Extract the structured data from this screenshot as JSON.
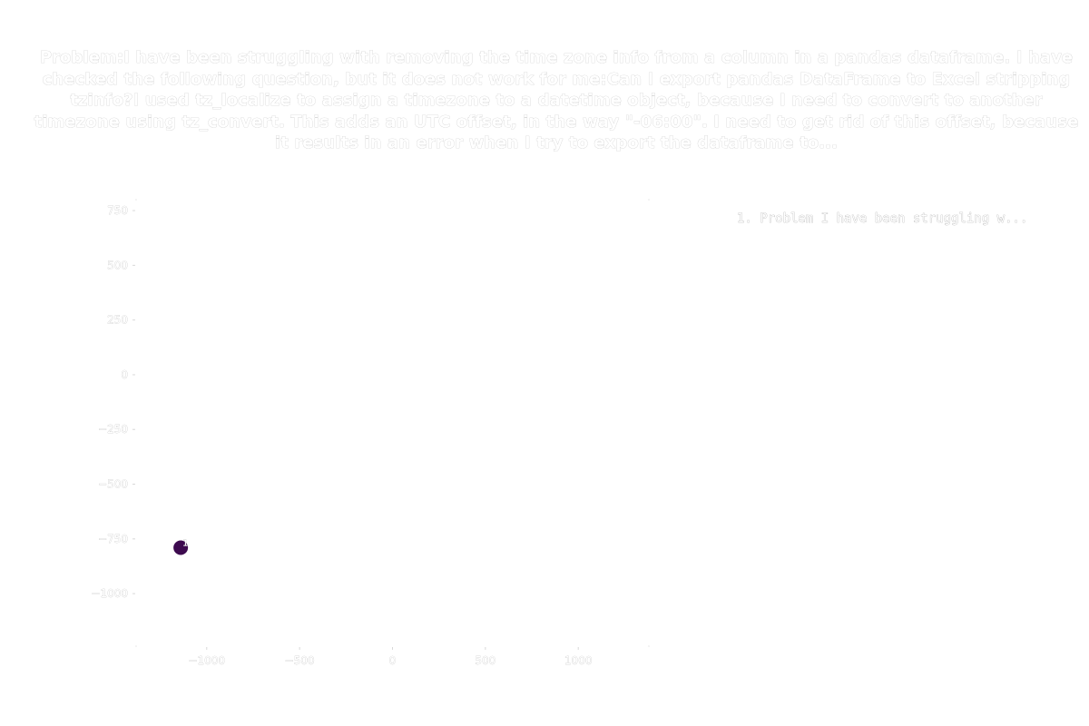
{
  "chart_data": {
    "type": "scatter",
    "title": "Problem:I have been struggling with removing the time zone info from a column in a pandas dataframe. I have checked the following question, but it does not work for me:Can I export pandas DataFrame to Excel stripping tzinfo?I used tz_localize to assign a timezone to a datetime object, because I need to convert to another timezone using tz_convert. This adds an UTC offset, in the way \"-06:00\". I need to get rid of this offset, because it results in an error when I try to export the dataframe to...",
    "xlabel": "",
    "ylabel": "",
    "xlim": [
      -1380,
      1380
    ],
    "ylim": [
      -1240,
      800
    ],
    "xticks": [
      -1000,
      -500,
      0,
      500,
      1000
    ],
    "xtick_labels": [
      "−1000",
      "−500",
      "0",
      "500",
      "1000"
    ],
    "yticks": [
      750,
      500,
      250,
      0,
      -250,
      -500,
      -750,
      -1000
    ],
    "ytick_labels": [
      "750",
      "500",
      "250",
      "0",
      "−250",
      "−500",
      "−750",
      "−1000"
    ],
    "grid": false,
    "legend_placement": "top-right",
    "series": [
      {
        "name": "1. Problem I have been struggling w...",
        "color": "#3d0a4f",
        "points": [
          {
            "x": -1140,
            "y": -790,
            "label": "1"
          }
        ]
      }
    ]
  }
}
